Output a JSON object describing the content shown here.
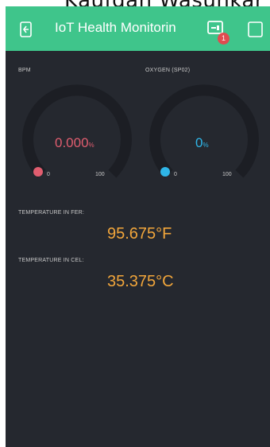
{
  "overlay_text": "Kaufdan Wasunkar E",
  "header": {
    "title": "IoT Health Monitorin",
    "back_icon": "exit-icon",
    "device_icon": "device-icon",
    "stop_icon": "stop-icon",
    "notification_count": "1",
    "background_color": "#3fc58b"
  },
  "gauges": [
    {
      "label": "BPM",
      "value": "0.000",
      "unit": "%",
      "min": "0",
      "max": "100",
      "level": 0,
      "color": "#e05d6f"
    },
    {
      "label": "OXYGEN (SP02)",
      "value": "0",
      "unit": "%",
      "min": "0",
      "max": "100",
      "level": 0,
      "color": "#2fb6e8"
    }
  ],
  "readings": [
    {
      "label": "TEMPERATURE IN FER:",
      "value": "95.675°F"
    },
    {
      "label": "TEMPERATURE IN CEL:",
      "value": "35.375°C"
    }
  ],
  "theme": {
    "background": "#25282f",
    "value_color": "#f2a63b"
  }
}
